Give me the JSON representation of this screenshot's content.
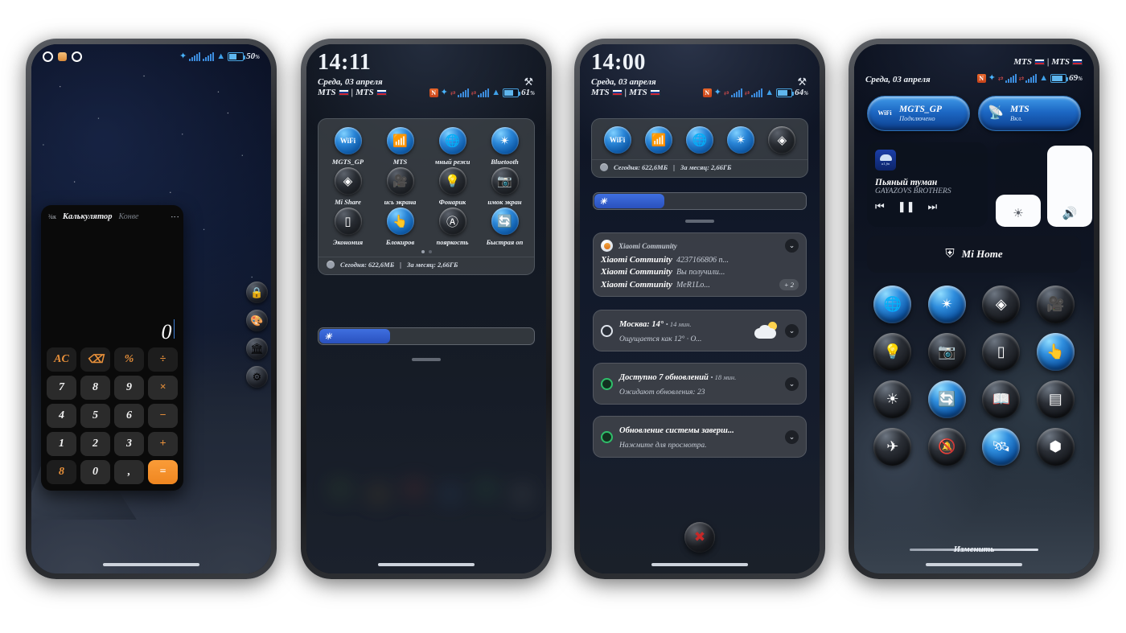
{
  "phone1": {
    "status": {
      "notif_icons": [
        "circle-outline-icon",
        "square-orange-icon",
        "circle-outline-icon"
      ],
      "bluetooth": "bluetooth-icon",
      "signal1": "signal-bars-icon",
      "signal2": "signal-bars-icon",
      "wifi": "wifi-icon",
      "battery_pct": "50",
      "pct_sign": "%"
    },
    "calculator": {
      "header_symbol": "¾к",
      "title": "Калькулятор",
      "tab2": "Конве",
      "menu": "⋮",
      "display_value": "0",
      "keys": [
        "AC",
        "⌫",
        "%",
        "÷",
        "7",
        "8",
        "9",
        "×",
        "4",
        "5",
        "6",
        "−",
        "1",
        "2",
        "3",
        "+",
        "8",
        "0",
        ",",
        "="
      ]
    },
    "side_apps": [
      {
        "name": "lock-app-icon",
        "glyph": "🔒"
      },
      {
        "name": "gallery-app-icon",
        "glyph": "🎨"
      },
      {
        "name": "store-app-icon",
        "glyph": "🏛"
      },
      {
        "name": "settings-app-icon",
        "glyph": "⚙"
      }
    ]
  },
  "phone2": {
    "clock": "14:11",
    "date": "Среда, 03 апреля",
    "carrier1": "MTS",
    "carrier2": "MTS",
    "separator": "|",
    "battery_pct": "61",
    "pct_sign": "%",
    "tools_icon": "⚒",
    "toggles": [
      {
        "label": "MGTS_GP",
        "icon": "wifi-icon",
        "glyph": "WiFi",
        "on": true
      },
      {
        "label": "MTS",
        "icon": "mobile-data-icon",
        "glyph": "📶",
        "on": true
      },
      {
        "label": "мный режи",
        "icon": "data-roaming-icon",
        "glyph": "🌐",
        "on": true
      },
      {
        "label": "Bluetooth",
        "icon": "bluetooth-icon",
        "glyph": "✴",
        "on": true
      },
      {
        "label": "Mi Share",
        "icon": "mi-share-icon",
        "glyph": "◈",
        "on": false
      },
      {
        "label": "ись экрана",
        "icon": "screen-record-icon",
        "glyph": "🎥",
        "on": false
      },
      {
        "label": "Фонарик",
        "icon": "flashlight-icon",
        "glyph": "💡",
        "on": false
      },
      {
        "label": "имок экран",
        "icon": "screenshot-icon",
        "glyph": "📷",
        "on": false
      },
      {
        "label": "Экономия",
        "icon": "battery-saver-icon",
        "glyph": "▯",
        "on": false
      },
      {
        "label": "Блокиров",
        "icon": "screen-lock-icon",
        "glyph": "👆",
        "on": true
      },
      {
        "label": "пояркость",
        "icon": "auto-brightness-icon",
        "glyph": "Ⓐ",
        "on": false
      },
      {
        "label": "Быстрая оп",
        "icon": "quick-pay-icon",
        "glyph": "🔄",
        "on": true
      }
    ],
    "page_dots": 2,
    "active_dot": 0,
    "data_today_label": "Сегодня: 622,6МБ",
    "data_month_label": "За месяц: 2,66ГБ",
    "data_separator": "|",
    "brightness_pct": 33
  },
  "phone3": {
    "clock": "14:00",
    "date": "Среда, 03 апреля",
    "carrier1": "MTS",
    "carrier2": "MTS",
    "separator": "|",
    "battery_pct": "64",
    "pct_sign": "%",
    "tools_icon": "⚒",
    "toggles": [
      {
        "label": "wifi-toggle",
        "glyph": "WiFi",
        "on": true
      },
      {
        "label": "mobile-data-toggle",
        "glyph": "📶",
        "on": true
      },
      {
        "label": "data-roaming-toggle",
        "glyph": "🌐",
        "on": true
      },
      {
        "label": "bluetooth-toggle",
        "glyph": "✴",
        "on": true
      },
      {
        "label": "mi-share-toggle",
        "glyph": "◈",
        "on": false
      }
    ],
    "data_today_label": "Сегодня: 622,6МБ",
    "data_month_label": "За месяц: 2,66ГБ",
    "data_separator": "|",
    "brightness_pct": 33,
    "notifications": [
      {
        "source": "Xiaomi Community",
        "chevron": "⌄",
        "lines": [
          {
            "bold": "Xiaomi Community",
            "rest": "4237166806 п..."
          },
          {
            "bold": "Xiaomi Community",
            "rest": "Вы получили..."
          },
          {
            "bold": "Xiaomi Community",
            "rest": "MeR1Lo...",
            "badge": "+ 2"
          }
        ]
      },
      {
        "icon": "weather-icon",
        "title": "Москва: 14°",
        "time": "• 14 мин.",
        "subtitle": "Ощущается как 12° · О...",
        "chevron": "⌄"
      },
      {
        "icon": "updates-icon",
        "title": "Доступно 7 обновлений",
        "time": "• 18 мин.",
        "subtitle": "Ожидают обновления: 23",
        "chevron": "⌄"
      },
      {
        "icon": "system-update-icon",
        "title": "Обновление системы заверш...",
        "time": "",
        "subtitle": "Нажмите для просмотра.",
        "chevron": "⌄"
      }
    ],
    "clear_button": "clear-all-notifications-icon"
  },
  "phone4": {
    "carrier1": "MTS",
    "carrier2": "MTS",
    "separator": "|",
    "date": "Среда, 03 апреля",
    "battery_pct": "69",
    "pct_sign": "%",
    "pills": [
      {
        "icon": "wifi-icon",
        "glyph": "WiFi",
        "title": "MGTS_GP",
        "sub": "Подключено"
      },
      {
        "icon": "mobile-data-icon",
        "glyph": "📡",
        "title": "MTS",
        "sub": "Вкл."
      }
    ],
    "media": {
      "album_label": "a1.fm",
      "title": "Пьяный туман",
      "artist": "GAYAZOVS BROTHERS",
      "prev": "⏮",
      "pause": "❚❚",
      "next": "⏭"
    },
    "brightness_slider": {
      "icon": "brightness-icon",
      "glyph": "☀",
      "fill_pct": 38
    },
    "volume_slider": {
      "icon": "volume-icon",
      "glyph": "🔊",
      "fill_pct": 96
    },
    "mihome": {
      "icon": "mi-home-icon",
      "label": "Mi Home"
    },
    "bubbles": [
      {
        "name": "data-roaming-toggle",
        "glyph": "🌐",
        "on": true
      },
      {
        "name": "bluetooth-toggle",
        "glyph": "✴",
        "on": true
      },
      {
        "name": "mi-share-toggle",
        "glyph": "◈",
        "on": false
      },
      {
        "name": "screen-record-toggle",
        "glyph": "🎥",
        "on": false
      },
      {
        "name": "flashlight-toggle",
        "glyph": "💡",
        "on": false
      },
      {
        "name": "screenshot-toggle",
        "glyph": "📷",
        "on": false
      },
      {
        "name": "battery-saver-toggle",
        "glyph": "▯",
        "on": false
      },
      {
        "name": "screen-lock-toggle",
        "glyph": "👆",
        "on": true
      },
      {
        "name": "auto-brightness-toggle",
        "glyph": "☀",
        "on": false
      },
      {
        "name": "sync-toggle",
        "glyph": "🔄",
        "on": true
      },
      {
        "name": "reading-mode-toggle",
        "glyph": "📖",
        "on": false
      },
      {
        "name": "wallet-toggle",
        "glyph": "▤",
        "on": false
      },
      {
        "name": "airplane-mode-toggle",
        "glyph": "✈",
        "on": false
      },
      {
        "name": "do-not-disturb-toggle",
        "glyph": "🔕",
        "on": false
      },
      {
        "name": "gps-toggle",
        "glyph": "🛰",
        "on": true
      },
      {
        "name": "settings-toggle",
        "glyph": "⬢",
        "on": false
      }
    ],
    "edit_label": "Изменить"
  }
}
